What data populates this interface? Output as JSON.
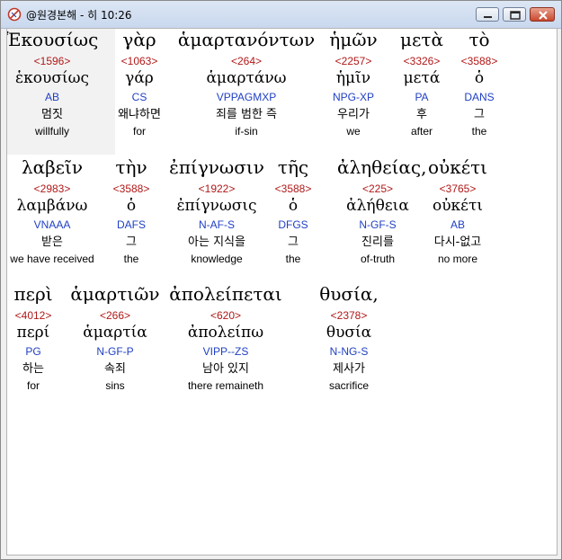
{
  "window": {
    "title": "@원경본해 - 히 10:26"
  },
  "rows": [
    [
      {
        "greek": "Ἑκουσίως",
        "strong": "<1596>",
        "lemma": "ἑκουσίως",
        "morph": "AB",
        "korean": "멈짓",
        "english": "willfully"
      },
      {
        "greek": "γὰρ",
        "strong": "<1063>",
        "lemma": "γάρ",
        "morph": "CS",
        "korean": "왜냐하면",
        "english": "for"
      },
      {
        "greek": "ἁμαρτανόντων",
        "strong": "<264>",
        "lemma": "ἁμαρτάνω",
        "morph": "VPPAGMXP",
        "korean": "죄를 범한 즉",
        "english": "if-sin"
      },
      {
        "greek": "ἡμῶν",
        "strong": "<2257>",
        "lemma": "ἡμῖν",
        "morph": "NPG-XP",
        "korean": "우리가",
        "english": "we"
      },
      {
        "greek": "μετὰ",
        "strong": "<3326>",
        "lemma": "μετά",
        "morph": "PA",
        "korean": "후",
        "english": "after"
      },
      {
        "greek": "τὸ",
        "strong": "<3588>",
        "lemma": "ὁ",
        "morph": "DANS",
        "korean": "그",
        "english": "the"
      }
    ],
    [
      {
        "greek": "λαβεῖν",
        "strong": "<2983>",
        "lemma": "λαμβάνω",
        "morph": "VNAAA",
        "korean": "받은",
        "english": "we have received"
      },
      {
        "greek": "τὴν",
        "strong": "<3588>",
        "lemma": "ὁ",
        "morph": "DAFS",
        "korean": "그",
        "english": "the"
      },
      {
        "greek": "ἐπίγνωσιν",
        "strong": "<1922>",
        "lemma": "ἐπίγνωσις",
        "morph": "N-AF-S",
        "korean": "아는 지식을",
        "english": "knowledge"
      },
      {
        "greek": "τῆς",
        "strong": "<3588>",
        "lemma": "ὁ",
        "morph": "DFGS",
        "korean": "그",
        "english": "the"
      },
      {
        "greek": "ἀληθείας,",
        "strong": "<225>",
        "lemma": "ἀλήθεια",
        "morph": "N-GF-S",
        "korean": "진리를",
        "english": "of-truth"
      },
      {
        "greek": "οὐκέτι",
        "strong": "<3765>",
        "lemma": "οὐκέτι",
        "morph": "AB",
        "korean": "다시-없고",
        "english": "no more"
      }
    ],
    [
      {
        "greek": "περὶ",
        "strong": "<4012>",
        "lemma": "περί",
        "morph": "PG",
        "korean": "하는",
        "english": "for"
      },
      {
        "greek": "ἁμαρτιῶν",
        "strong": "<266>",
        "lemma": "ἁμαρτία",
        "morph": "N-GF-P",
        "korean": "속죄",
        "english": "sins"
      },
      {
        "greek": "ἀπολείπεται",
        "strong": "<620>",
        "lemma": "ἀπολείπω",
        "morph": "VIPP--ZS",
        "korean": "남아 있지",
        "english": "there remaineth"
      },
      {
        "greek": "θυσία,",
        "strong": "<2378>",
        "lemma": "θυσία",
        "morph": "N-NG-S",
        "korean": "제사가",
        "english": "sacrifice"
      }
    ]
  ]
}
